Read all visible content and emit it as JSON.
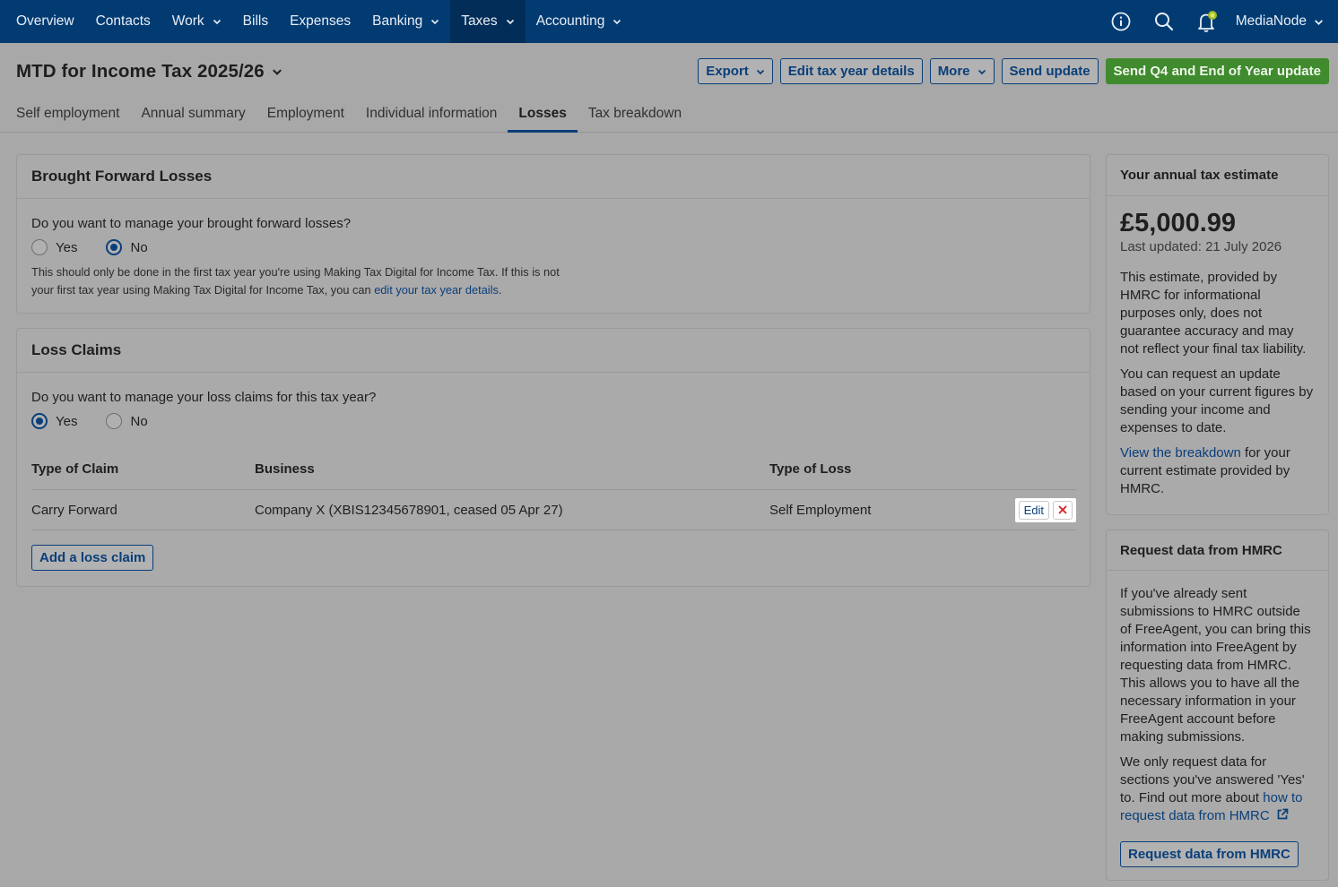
{
  "nav": {
    "items": [
      {
        "label": "Overview",
        "dropdown": false,
        "active": false
      },
      {
        "label": "Contacts",
        "dropdown": false,
        "active": false
      },
      {
        "label": "Work",
        "dropdown": true,
        "active": false
      },
      {
        "label": "Bills",
        "dropdown": false,
        "active": false
      },
      {
        "label": "Expenses",
        "dropdown": false,
        "active": false
      },
      {
        "label": "Banking",
        "dropdown": true,
        "active": false
      },
      {
        "label": "Taxes",
        "dropdown": true,
        "active": true
      },
      {
        "label": "Accounting",
        "dropdown": true,
        "active": false
      }
    ],
    "account": "MediaNode",
    "icons": [
      "info-icon",
      "search-icon",
      "notification-bell-icon"
    ]
  },
  "header": {
    "title": "MTD for Income Tax 2025/26",
    "export": "Export",
    "edit_tax_year": "Edit tax year details",
    "more": "More",
    "send_update": "Send update",
    "send_final": "Send Q4 and End of Year update"
  },
  "tabs": [
    {
      "label": "Self employment",
      "active": false
    },
    {
      "label": "Annual summary",
      "active": false
    },
    {
      "label": "Employment",
      "active": false
    },
    {
      "label": "Individual information",
      "active": false
    },
    {
      "label": "Losses",
      "active": true
    },
    {
      "label": "Tax breakdown",
      "active": false
    }
  ],
  "brought_forward": {
    "title": "Brought Forward Losses",
    "question": "Do you want to manage your brought forward losses?",
    "yes": "Yes",
    "no": "No",
    "selected": "No",
    "note_1": "This should only be done in the first tax year you're using Making Tax Digital for Income Tax. If this is not your first tax year using Making Tax Digital for Income Tax, you can ",
    "note_link": "edit your tax year details",
    "note_2": "."
  },
  "loss_claims": {
    "title": "Loss Claims",
    "question": "Do you want to manage your loss claims for this tax year?",
    "yes": "Yes",
    "no": "No",
    "selected": "Yes",
    "columns": [
      "Type of Claim",
      "Business",
      "Type of Loss"
    ],
    "rows": [
      {
        "type": "Carry Forward",
        "business": "Company X (XBIS12345678901, ceased 05 Apr 27)",
        "loss": "Self Employment",
        "edit": "Edit"
      }
    ],
    "add_button": "Add a loss claim"
  },
  "estimate": {
    "title": "Your annual tax estimate",
    "amount": "£5,000.99",
    "updated": "Last updated: 21 July 2026",
    "para1": "This estimate, provided by HMRC for informational purposes only, does not guarantee accuracy and may not reflect your final tax liability.",
    "para2": "You can request an update based on your current figures by sending your income and expenses to date.",
    "link": "View the breakdown",
    "para3": " for your current estimate provided by HMRC."
  },
  "request": {
    "title": "Request data from HMRC",
    "para1": "If you've already sent submissions to HMRC outside of FreeAgent, you can bring this information into FreeAgent by requesting data from HMRC. This allows you to have all the necessary information in your FreeAgent account before making submissions.",
    "para2": "We only request data for sections you've answered 'Yes' to. Find out more about ",
    "link": "how to request data from HMRC",
    "button": "Request data from HMRC"
  },
  "colors": {
    "nav_bg": "#023b72",
    "primary_green": "#3f8b2e",
    "link_blue": "#0a3f7a",
    "delete_red": "#d42020"
  }
}
